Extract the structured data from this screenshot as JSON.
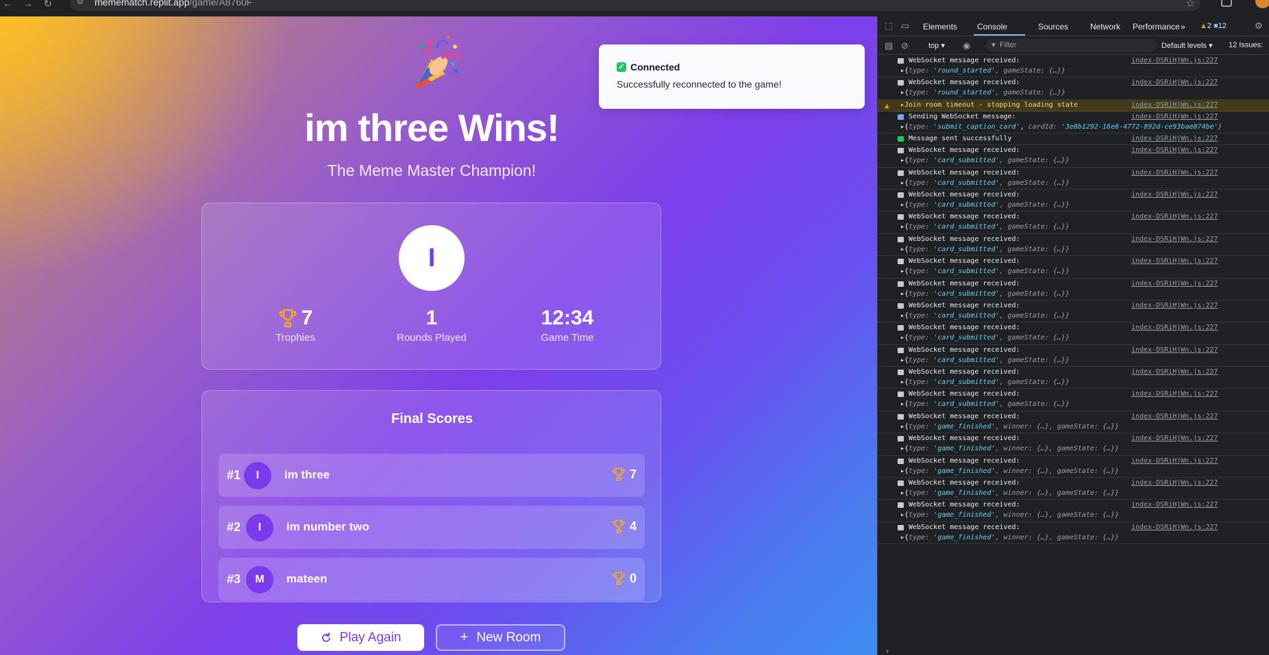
{
  "browser": {
    "url_host": "memematch.replit.app",
    "url_path": "/game/A8760F"
  },
  "game": {
    "winner_title": "im three Wins!",
    "winner_subtitle": "The Meme Master Champion!",
    "winner_initial": "I",
    "stats": {
      "trophies": "7",
      "trophies_label": "Trophies",
      "rounds": "1",
      "rounds_label": "Rounds Played",
      "time": "12:34",
      "time_label": "Game Time"
    },
    "scores_title": "Final Scores",
    "players": [
      {
        "rank": "#1",
        "initial": "I",
        "name": "im three",
        "score": "7"
      },
      {
        "rank": "#2",
        "initial": "I",
        "name": "im number two",
        "score": "4"
      },
      {
        "rank": "#3",
        "initial": "M",
        "name": "mateen",
        "score": "0"
      }
    ],
    "play_again_label": "Play Again",
    "new_room_label": "New Room"
  },
  "toast": {
    "title": "Connected",
    "message": "Successfully reconnected to the game!"
  },
  "devtools": {
    "tabs": [
      "Elements",
      "Console",
      "Sources",
      "Network",
      "Performance"
    ],
    "warnings": "2",
    "infos": "12",
    "context": "top",
    "filter_placeholder": "Filter",
    "levels": "Default levels",
    "issues": "12 Issues:",
    "source": "index-DSRiHjWn.js:227"
  },
  "console_log": [
    {
      "kind": "recv",
      "l1": "WebSocket message received:",
      "args": [
        [
          "type",
          "round_started"
        ]
      ],
      "tail": "gameState: {…}}"
    },
    {
      "kind": "recv",
      "l1": "WebSocket message received:",
      "args": [
        [
          "type",
          "round_started"
        ]
      ],
      "tail": "gameState: {…}}"
    },
    {
      "kind": "warn",
      "l1": "Join room timeout - stopping loading state"
    },
    {
      "kind": "send",
      "l1": "Sending WebSocket message:",
      "args": [
        [
          "type",
          "submit_caption_card"
        ],
        [
          "cardId",
          "3e0b1292-16e6-4772-892d-ce93bae074be"
        ]
      ],
      "tail": "}"
    },
    {
      "kind": "ok",
      "l1": "Message sent successfully"
    },
    {
      "kind": "recv",
      "l1": "WebSocket message received:",
      "args": [
        [
          "type",
          "card_submitted"
        ]
      ],
      "tail": "gameState: {…}}"
    },
    {
      "kind": "recv",
      "l1": "WebSocket message received:",
      "args": [
        [
          "type",
          "card_submitted"
        ]
      ],
      "tail": "gameState: {…}}"
    },
    {
      "kind": "recv",
      "l1": "WebSocket message received:",
      "args": [
        [
          "type",
          "card_submitted"
        ]
      ],
      "tail": "gameState: {…}}"
    },
    {
      "kind": "recv",
      "l1": "WebSocket message received:",
      "args": [
        [
          "type",
          "card_submitted"
        ]
      ],
      "tail": "gameState: {…}}"
    },
    {
      "kind": "recv",
      "l1": "WebSocket message received:",
      "args": [
        [
          "type",
          "card_submitted"
        ]
      ],
      "tail": "gameState: {…}}"
    },
    {
      "kind": "recv",
      "l1": "WebSocket message received:",
      "args": [
        [
          "type",
          "card_submitted"
        ]
      ],
      "tail": "gameState: {…}}"
    },
    {
      "kind": "recv",
      "l1": "WebSocket message received:",
      "args": [
        [
          "type",
          "card_submitted"
        ]
      ],
      "tail": "gameState: {…}}"
    },
    {
      "kind": "recv",
      "l1": "WebSocket message received:",
      "args": [
        [
          "type",
          "card_submitted"
        ]
      ],
      "tail": "gameState: {…}}"
    },
    {
      "kind": "recv",
      "l1": "WebSocket message received:",
      "args": [
        [
          "type",
          "card_submitted"
        ]
      ],
      "tail": "gameState: {…}}"
    },
    {
      "kind": "recv",
      "l1": "WebSocket message received:",
      "args": [
        [
          "type",
          "card_submitted"
        ]
      ],
      "tail": "gameState: {…}}"
    },
    {
      "kind": "recv",
      "l1": "WebSocket message received:",
      "args": [
        [
          "type",
          "card_submitted"
        ]
      ],
      "tail": "gameState: {…}}"
    },
    {
      "kind": "recv",
      "l1": "WebSocket message received:",
      "args": [
        [
          "type",
          "card_submitted"
        ]
      ],
      "tail": "gameState: {…}}"
    },
    {
      "kind": "recv",
      "l1": "WebSocket message received:",
      "args": [
        [
          "type",
          "game_finished"
        ]
      ],
      "tail": "winner: {…}, gameState: {…}}"
    },
    {
      "kind": "recv",
      "l1": "WebSocket message received:",
      "args": [
        [
          "type",
          "game_finished"
        ]
      ],
      "tail": "winner: {…}, gameState: {…}}"
    },
    {
      "kind": "recv",
      "l1": "WebSocket message received:",
      "args": [
        [
          "type",
          "game_finished"
        ]
      ],
      "tail": "winner: {…}, gameState: {…}}"
    },
    {
      "kind": "recv",
      "l1": "WebSocket message received:",
      "args": [
        [
          "type",
          "game_finished"
        ]
      ],
      "tail": "winner: {…}, gameState: {…}}"
    },
    {
      "kind": "recv",
      "l1": "WebSocket message received:",
      "args": [
        [
          "type",
          "game_finished"
        ]
      ],
      "tail": "winner: {…}, gameState: {…}}"
    },
    {
      "kind": "recv",
      "l1": "WebSocket message received:",
      "args": [
        [
          "type",
          "game_finished"
        ]
      ],
      "tail": "winner: {…}, gameState: {…}}"
    }
  ],
  "colors": {
    "accent": "#7c3aed",
    "trophy": "#f5a623",
    "link": "#8ab4f8",
    "success": "#22c55e"
  },
  "icons": {
    "trophy": "trophy-icon",
    "party": "party-popper-icon",
    "refresh": "refresh-icon",
    "plus": "plus-icon",
    "check": "check-icon"
  }
}
